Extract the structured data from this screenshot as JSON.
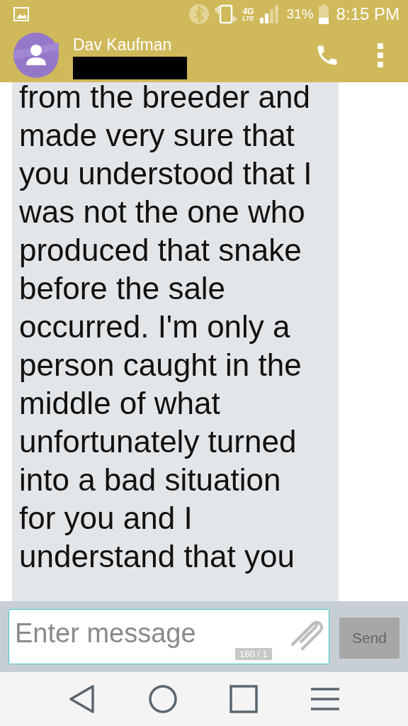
{
  "status_bar": {
    "network": "4G",
    "network_sub": "LTE",
    "battery": "31%",
    "time": "8:15 PM"
  },
  "header": {
    "contact_name": "Dav Kaufman"
  },
  "message": {
    "text": "from the breeder and\nmade very sure that\nyou understood that I\nwas not the one who\nproduced that snake\nbefore the sale\noccurred. I'm only a\nperson caught in the\nmiddle of what\nunfortunately turned\ninto a bad situation\nfor you and I\nunderstand that you"
  },
  "composer": {
    "placeholder": "Enter message",
    "counter": "160 / 1",
    "send": "Send"
  }
}
